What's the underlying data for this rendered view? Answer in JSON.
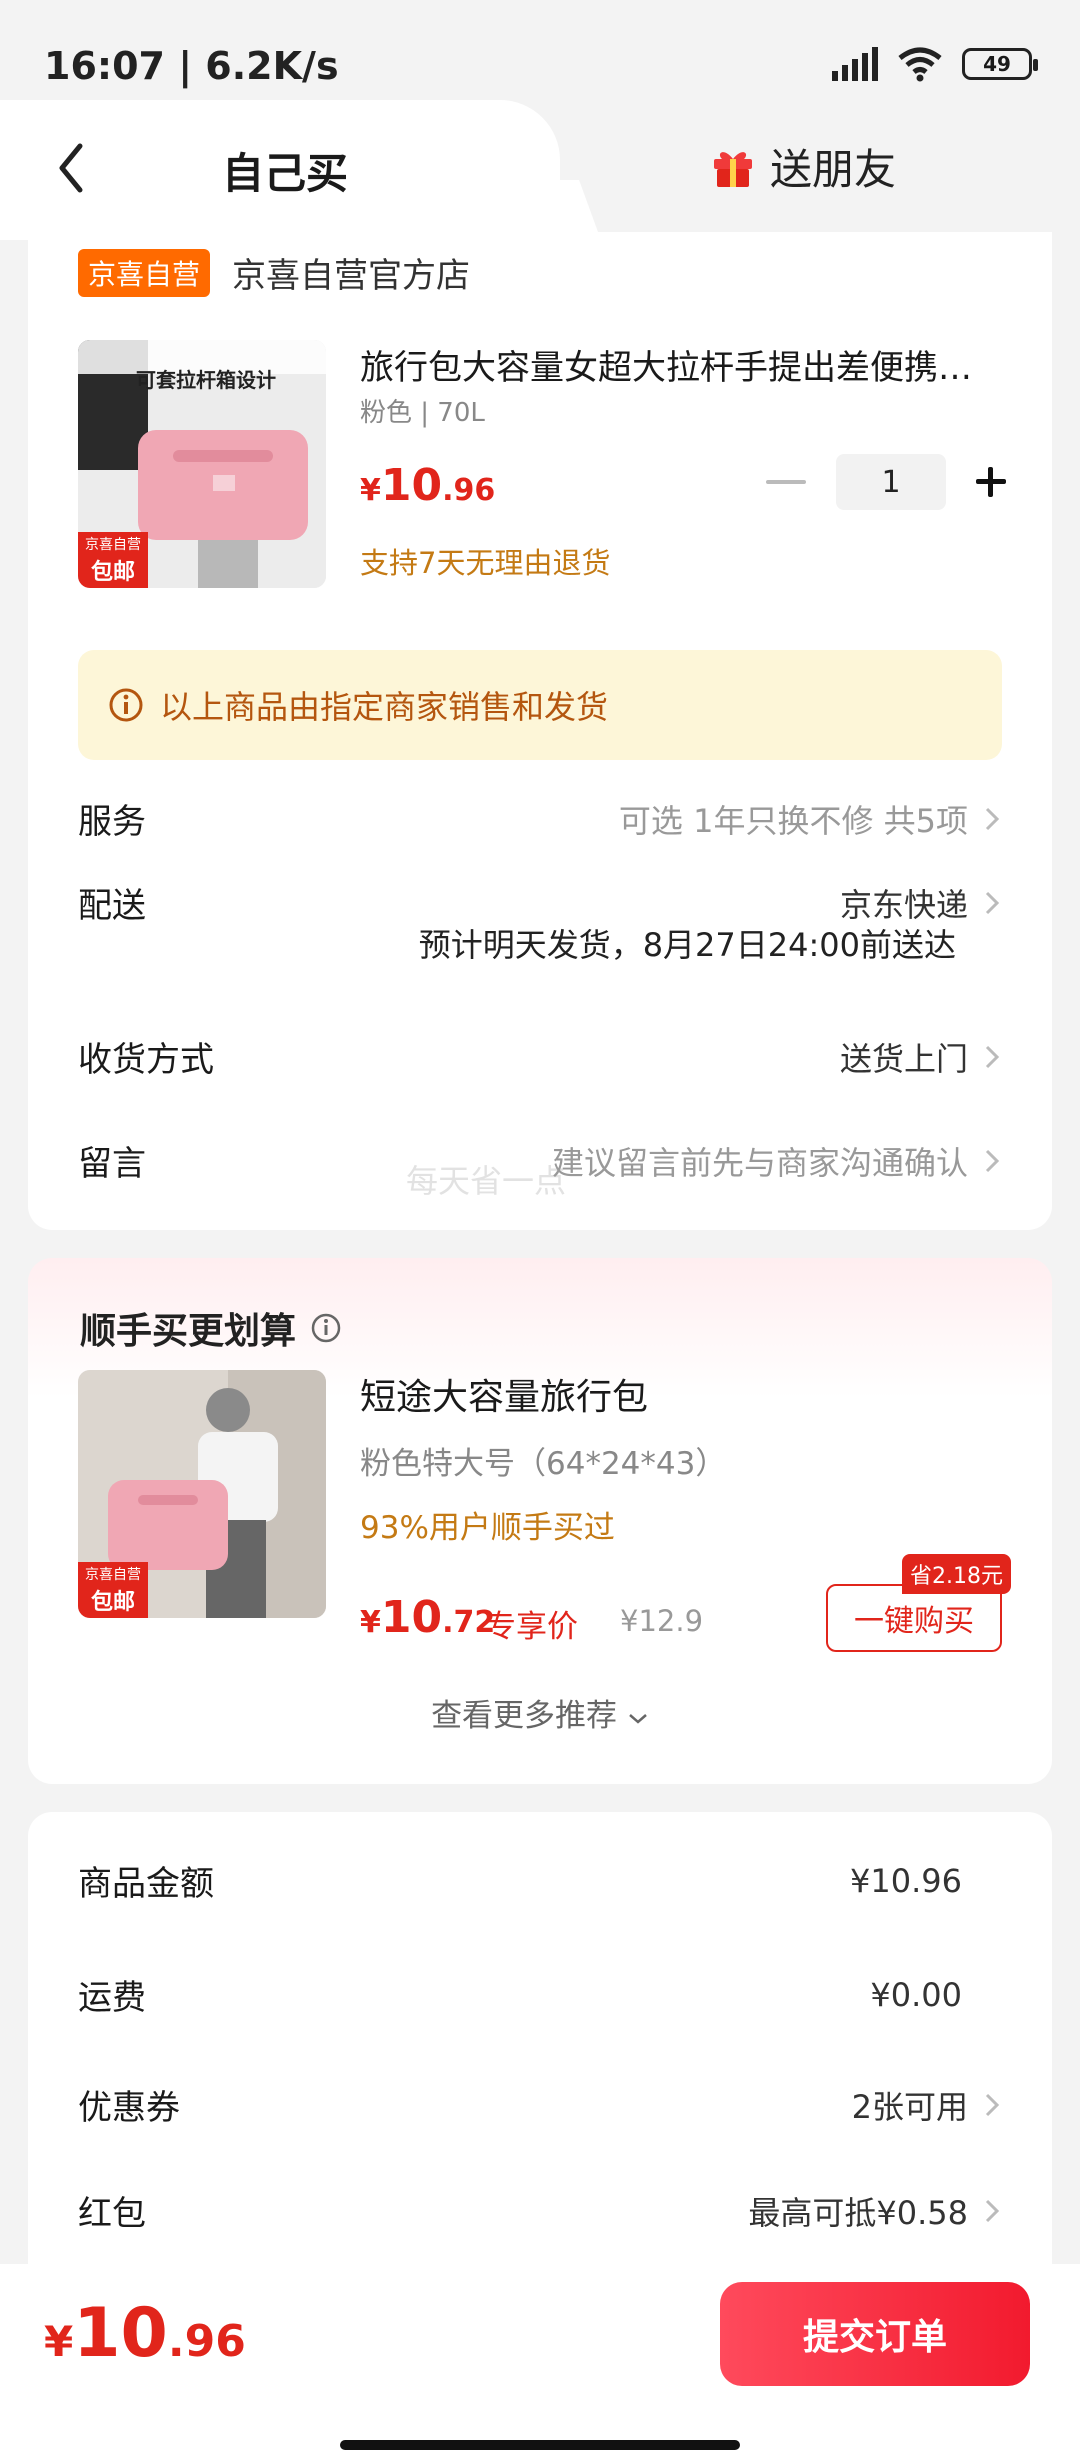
{
  "status": {
    "time": "16:07 | 6.2K/s",
    "battery": "49"
  },
  "tabs": {
    "self_buy": "自己买",
    "gift": "送朋友"
  },
  "shop": {
    "badge": "京喜自营",
    "name": "京喜自营官方店"
  },
  "product": {
    "title": "旅行包大容量女超大拉杆手提出差便携…",
    "spec": "粉色 | 70L",
    "price": {
      "yen": "¥",
      "int": "10",
      "dec": ".96"
    },
    "return_note": "支持7天无理由退货",
    "quantity": "1",
    "thumb_caption": "可套拉杆箱设计",
    "thumb_badge": {
      "line1": "京喜自营",
      "line2": "包邮"
    }
  },
  "notice": {
    "text": "以上商品由指定商家销售和发货"
  },
  "options": {
    "service": {
      "label": "服务",
      "value": "可选 1年只换不修 共5项"
    },
    "delivery": {
      "label": "配送",
      "value": "京东快递",
      "sub": "预计明天发货，8月27日24:00前送达"
    },
    "receive": {
      "label": "收货方式",
      "value": "送货上门"
    },
    "message": {
      "label": "留言",
      "value": "建议留言前先与商家沟通确认"
    }
  },
  "watermark": "每天省一点",
  "recommend": {
    "title": "顺手买更划算",
    "name": "短途大容量旅行包",
    "spec": "粉色特大号（64*24*43）",
    "popularity": "93%用户顺手买过",
    "price": {
      "yen": "¥",
      "int": "10",
      "dec": ".72"
    },
    "exclusive_label": "专享价",
    "original_price": "¥12.9",
    "save_badge": "省2.18元",
    "buy_label": "一键购买",
    "thumb_badge": {
      "line1": "京喜自营",
      "line2": "包邮"
    },
    "more_label": "查看更多推荐"
  },
  "totals": {
    "goods": {
      "label": "商品金额",
      "value": "¥10.96"
    },
    "shipping": {
      "label": "运费",
      "value": "¥0.00"
    },
    "coupon": {
      "label": "优惠券",
      "value": "2张可用"
    },
    "red_packet": {
      "label": "红包",
      "value": "最高可抵¥0.58"
    }
  },
  "footer": {
    "total": {
      "yen": "¥",
      "int": "10",
      "dec": ".96"
    },
    "submit_label": "提交订单"
  },
  "colors": {
    "accent": "#e1251b",
    "self_badge": "#ff6a00",
    "notice_bg": "#fdf6d8",
    "notice_text": "#b4560f"
  }
}
